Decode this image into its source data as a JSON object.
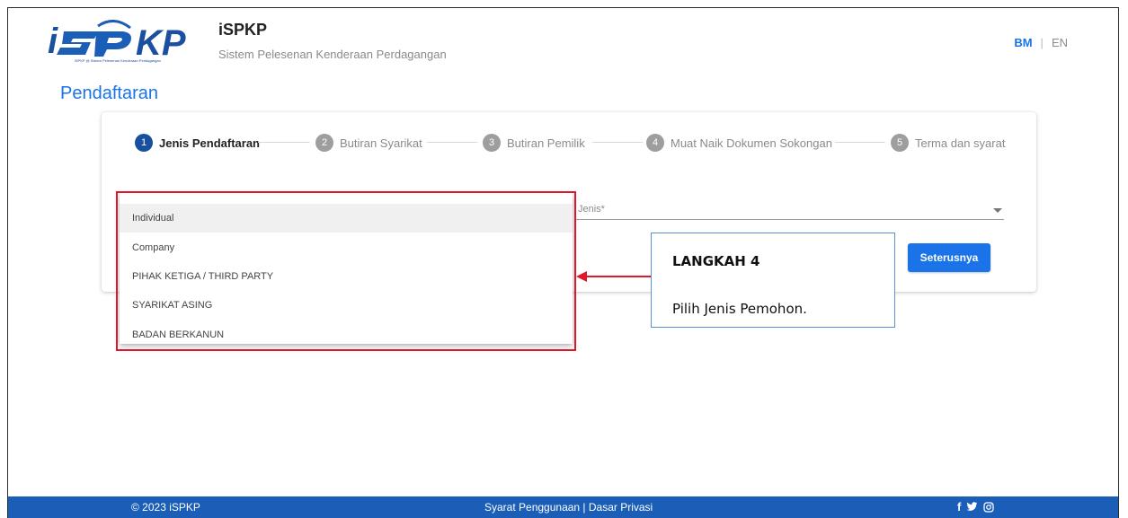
{
  "header": {
    "app_title": "iSPKP",
    "app_subtitle": "Sistem Pelesenan Kenderaan Perdagangan",
    "lang_bm": "BM",
    "lang_sep": "|",
    "lang_en": "EN",
    "logo_text": "iSPKP"
  },
  "page": {
    "title": "Pendaftaran"
  },
  "stepper": {
    "steps": [
      {
        "num": "1",
        "label": "Jenis Pendaftaran",
        "active": true
      },
      {
        "num": "2",
        "label": "Butiran Syarikat",
        "active": false
      },
      {
        "num": "3",
        "label": "Butiran Pemilik",
        "active": false
      },
      {
        "num": "4",
        "label": "Muat Naik Dokumen Sokongan",
        "active": false
      },
      {
        "num": "5",
        "label": "Terma dan syarat",
        "active": false
      }
    ]
  },
  "form": {
    "jenis_label": "Jenis*",
    "next_button": "Seterusnya"
  },
  "dropdown": {
    "options": [
      {
        "label": "Individual",
        "selected": true
      },
      {
        "label": "Company",
        "selected": false
      },
      {
        "label": "PIHAK KETIGA / THIRD PARTY",
        "selected": false
      },
      {
        "label": "SYARIKAT ASING",
        "selected": false
      },
      {
        "label": "BADAN BERKANUN",
        "selected": false
      }
    ]
  },
  "callout": {
    "title": "LANGKAH 4",
    "text": "Pilih Jenis Pemohon."
  },
  "footer": {
    "copyright": "© 2023 iSPKP",
    "links": "Syarat Penggunaan | Dasar Privasi"
  },
  "colors": {
    "accent": "#1a73e8",
    "footer_bg": "#1b5eb7",
    "annotation_red": "#e0162b",
    "callout_border": "#5b8fd6"
  }
}
